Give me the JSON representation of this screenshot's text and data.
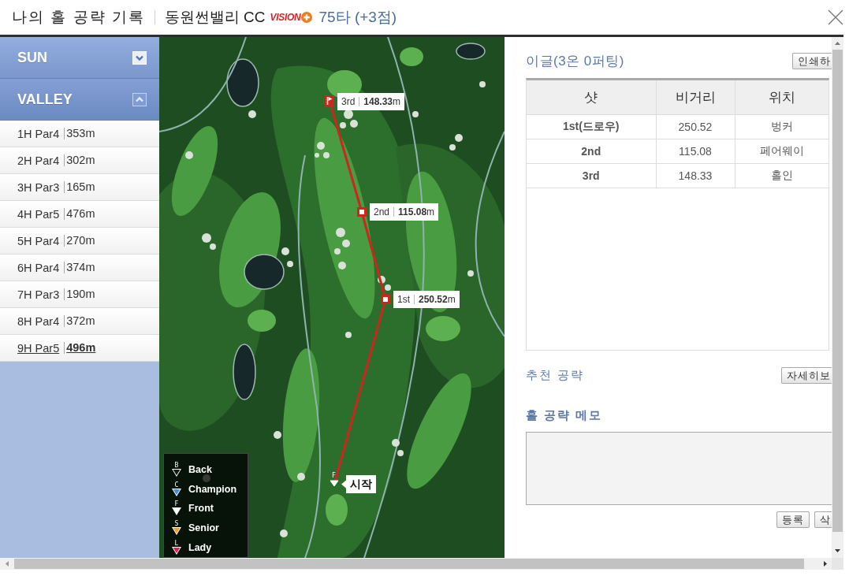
{
  "header": {
    "title": "나의 홀 공략 기록",
    "course": "동원썬밸리 CC",
    "logo": "VISION",
    "score": "75타 (+3점)"
  },
  "sidebar": {
    "sections": [
      {
        "name": "SUN",
        "expanded": false
      },
      {
        "name": "VALLEY",
        "expanded": true,
        "holes": [
          {
            "label": "1H Par4",
            "distance": "353m",
            "selected": false
          },
          {
            "label": "2H Par4",
            "distance": "302m",
            "selected": false
          },
          {
            "label": "3H Par3",
            "distance": "165m",
            "selected": false
          },
          {
            "label": "4H Par5",
            "distance": "476m",
            "selected": false
          },
          {
            "label": "5H Par4",
            "distance": "270m",
            "selected": false
          },
          {
            "label": "6H Par4",
            "distance": "374m",
            "selected": false
          },
          {
            "label": "7H Par3",
            "distance": "190m",
            "selected": false
          },
          {
            "label": "8H Par4",
            "distance": "372m",
            "selected": false
          },
          {
            "label": "9H Par5",
            "distance": "496m",
            "selected": true
          }
        ]
      }
    ]
  },
  "map": {
    "shots": [
      {
        "kind": "marker",
        "label": "1st",
        "distance": "**250.52**m"
      },
      {
        "kind": "marker",
        "label": "2nd",
        "distance": "**115.08**m"
      },
      {
        "kind": "flag",
        "label": "3rd",
        "distance": "**148.33**m"
      }
    ],
    "start": {
      "tee_letter": "F",
      "label": "시작"
    },
    "legend": [
      {
        "letter": "B",
        "name": "Back",
        "color": "#1a1a1a"
      },
      {
        "letter": "C",
        "name": "Champion",
        "color": "#3d8ed8"
      },
      {
        "letter": "F",
        "name": "Front",
        "color": "#ffffff"
      },
      {
        "letter": "S",
        "name": "Senior",
        "color": "#f0a028"
      },
      {
        "letter": "L",
        "name": "Lady",
        "color": "#e0224c"
      }
    ]
  },
  "result": {
    "title": "이글(3온 0퍼팅)",
    "print_button": "인쇄하",
    "table": {
      "columns": [
        "샷",
        "비거리",
        "위치"
      ],
      "rows": [
        [
          "1st(드로우)",
          "250.52",
          "벙커"
        ],
        [
          "2nd",
          "115.08",
          "페어웨이"
        ],
        [
          "3rd",
          "148.33",
          "홀인"
        ]
      ]
    }
  },
  "recommend": {
    "label": "추천 공략",
    "button": "자세히보"
  },
  "memo": {
    "label": "홀 공략 메모",
    "buttons": [
      "등록",
      "삭"
    ]
  }
}
